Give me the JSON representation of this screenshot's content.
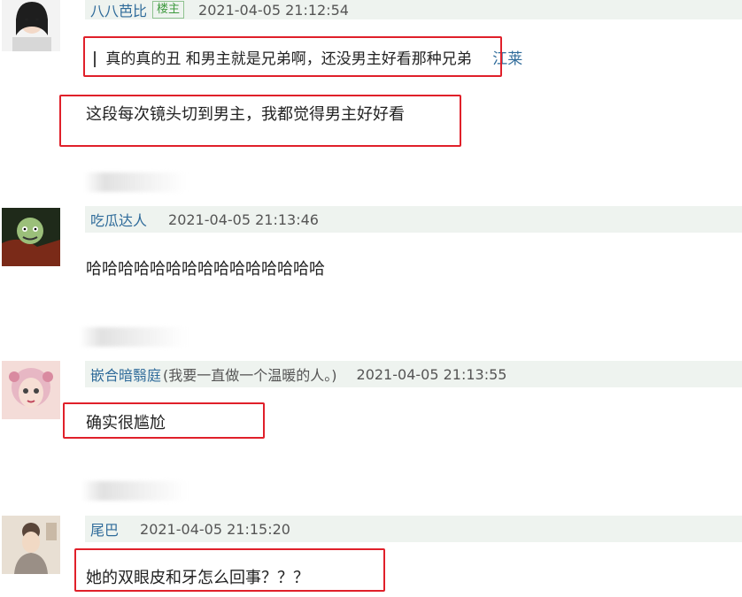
{
  "comments": [
    {
      "username": "八八芭比",
      "badge": "楼主",
      "timestamp": "2021-04-05 21:12:54",
      "quote": "真的真的丑 和男主就是兄弟啊，还没男主好看那种兄弟",
      "quote_author": "江莱",
      "content": "这段每次镜头切到男主，我都觉得男主好好看"
    },
    {
      "username": "吃瓜达人",
      "timestamp": "2021-04-05 21:13:46",
      "content": "哈哈哈哈哈哈哈哈哈哈哈哈哈哈哈"
    },
    {
      "username": "嵌合暗翳庭",
      "note": "(我要一直做一个温暖的人。)",
      "timestamp": "2021-04-05 21:13:55",
      "content": "确实很尴尬"
    },
    {
      "username": "尾巴",
      "timestamp": "2021-04-05 21:15:20",
      "content": "她的双眼皮和牙怎么回事？？？"
    }
  ],
  "colors": {
    "meta_bar_bg": "#eef3ef",
    "username": "#2f6b9a",
    "highlight_box": "#e0202a",
    "badge": "#3f9a3f"
  }
}
